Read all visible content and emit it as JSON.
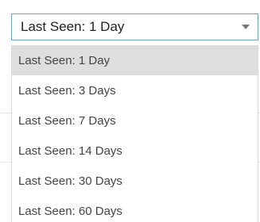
{
  "select": {
    "value": "Last Seen: 1 Day",
    "options": [
      {
        "label": "Last Seen: 1 Day",
        "selected": true
      },
      {
        "label": "Last Seen: 3 Days",
        "selected": false
      },
      {
        "label": "Last Seen: 7 Days",
        "selected": false
      },
      {
        "label": "Last Seen: 14 Days",
        "selected": false
      },
      {
        "label": "Last Seen: 30 Days",
        "selected": false
      },
      {
        "label": "Last Seen: 60 Days",
        "selected": false
      }
    ]
  },
  "colors": {
    "border_focus": "#6b9fd6",
    "highlight": "#dedede",
    "text": "#444444"
  }
}
